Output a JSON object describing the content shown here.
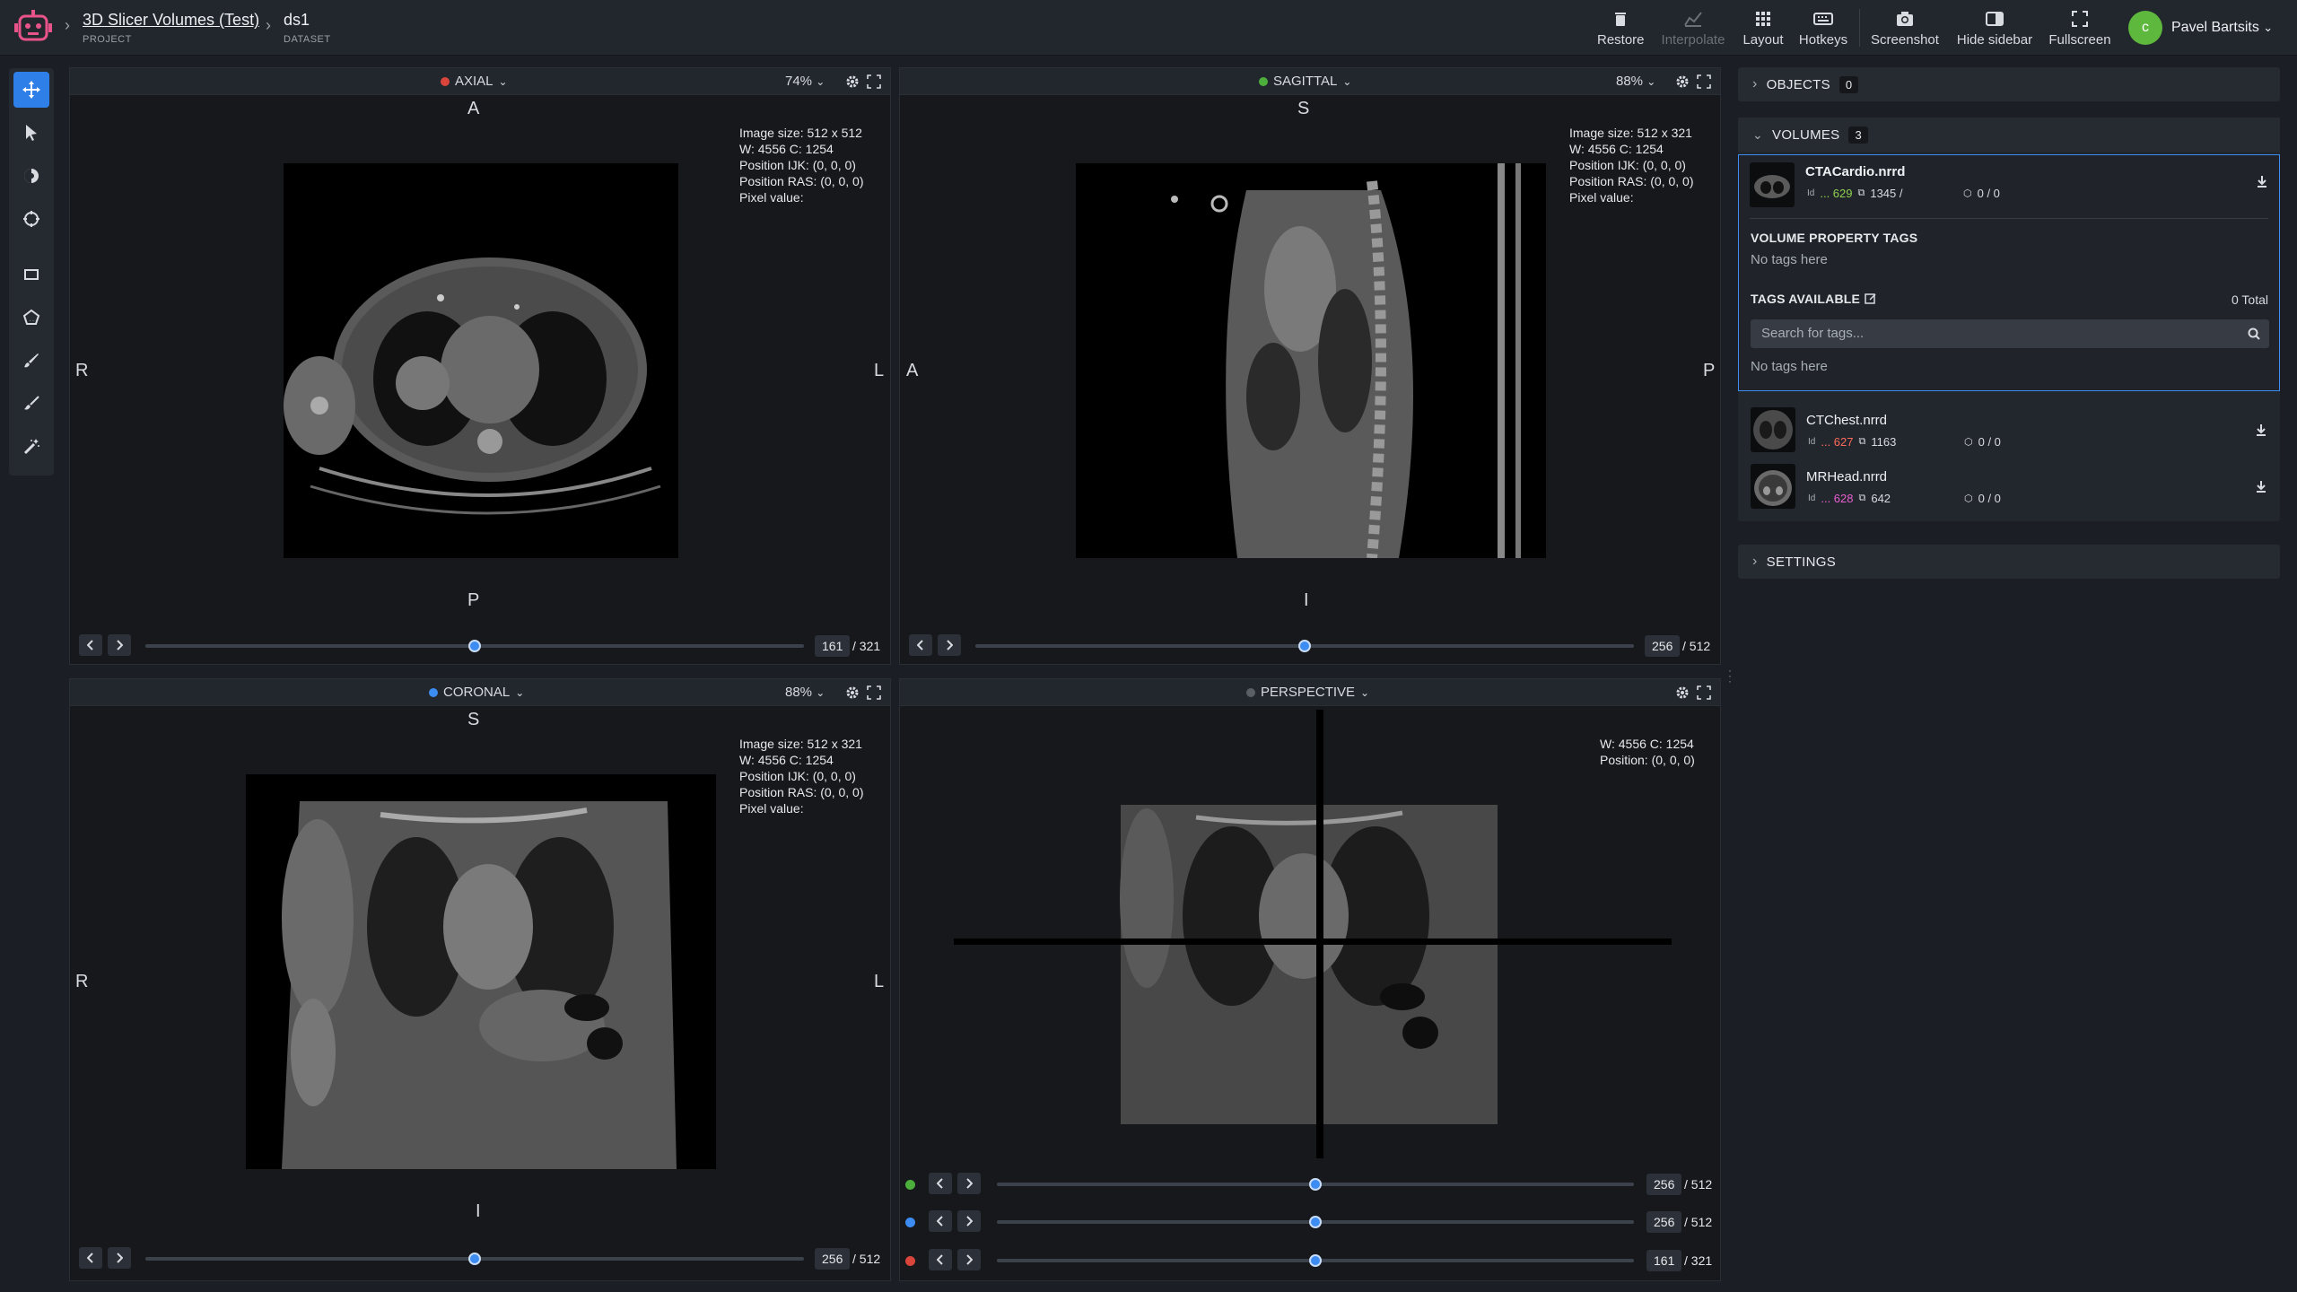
{
  "header": {
    "project_title": "3D Slicer Volumes (Test)",
    "project_label": "PROJECT",
    "dataset_title": "ds1",
    "dataset_label": "DATASET",
    "actions": [
      {
        "label": "Restore",
        "icon": "trash-icon",
        "disabled": false
      },
      {
        "label": "Interpolate",
        "icon": "chart-icon",
        "disabled": true
      },
      {
        "label": "Layout",
        "icon": "grid-icon",
        "disabled": false
      },
      {
        "label": "Hotkeys",
        "icon": "keyboard-icon",
        "disabled": false
      },
      {
        "label": "Screenshot",
        "icon": "camera-icon",
        "disabled": false
      },
      {
        "label": "Hide sidebar",
        "icon": "sidebar-icon",
        "disabled": false
      },
      {
        "label": "Fullscreen",
        "icon": "fullscreen-icon",
        "disabled": false
      }
    ],
    "user": {
      "initial": "c",
      "name": "Pavel Bartsits"
    }
  },
  "tools": [
    "move-icon",
    "pointer-icon",
    "brightness-icon",
    "point-icon",
    "rectangle-icon",
    "polygon-icon",
    "brush-icon",
    "eraser-brush-icon",
    "magic-wand-icon"
  ],
  "viewports": {
    "axial": {
      "title": "AXIAL",
      "color": "#d9453b",
      "zoom": "74%",
      "orient": {
        "top": "A",
        "bottom": "P",
        "left": "R",
        "right": "L"
      },
      "info": [
        "Image size: 512 x 512",
        "W: 4556 C: 1254",
        "Position IJK: (0, 0, 0)",
        "Position RAS: (0, 0, 0)",
        "Pixel value:"
      ],
      "slice": "161",
      "total": "/ 321",
      "fraction": 0.5
    },
    "sagittal": {
      "title": "SAGITTAL",
      "color": "#4caf3c",
      "zoom": "88%",
      "orient": {
        "top": "S",
        "bottom": "I",
        "left": "A",
        "right": "P"
      },
      "info": [
        "Image size: 512 x 321",
        "W: 4556 C: 1254",
        "Position IJK: (0, 0, 0)",
        "Position RAS: (0, 0, 0)",
        "Pixel value:"
      ],
      "slice": "256",
      "total": "/ 512",
      "fraction": 0.5
    },
    "coronal": {
      "title": "CORONAL",
      "color": "#3d8cf2",
      "zoom": "88%",
      "orient": {
        "top": "S",
        "bottom": "I",
        "left": "R",
        "right": "L"
      },
      "info": [
        "Image size: 512 x 321",
        "W: 4556 C: 1254",
        "Position IJK: (0, 0, 0)",
        "Position RAS: (0, 0, 0)",
        "Pixel value:"
      ],
      "slice": "256",
      "total": "/ 512",
      "fraction": 0.5
    },
    "perspective": {
      "title": "PERSPECTIVE",
      "color": "#5a5f66",
      "info": [
        "W: 4556 C: 1254",
        "Position: (0, 0, 0)"
      ],
      "sliders": [
        {
          "color": "#4caf3c",
          "slice": "256",
          "total": "/ 512",
          "fraction": 0.5
        },
        {
          "color": "#3d8cf2",
          "slice": "256",
          "total": "/ 512",
          "fraction": 0.5
        },
        {
          "color": "#d9453b",
          "slice": "161",
          "total": "/ 321",
          "fraction": 0.5
        }
      ]
    }
  },
  "sidebar": {
    "objects": {
      "label": "OBJECTS",
      "count": "0"
    },
    "volumes": {
      "label": "VOLUMES",
      "count": "3"
    },
    "settings": {
      "label": "SETTINGS"
    },
    "volume_items": [
      {
        "name": "CTACardio.nrrd",
        "id": "... 629",
        "id_color": "#8fd14f",
        "frames": "1345 /",
        "objects": "0 / 0"
      },
      {
        "name": "CTChest.nrrd",
        "id": "... 627",
        "id_color": "#ff6b5a",
        "frames": "1163",
        "objects": "0 / 0"
      },
      {
        "name": "MRHead.nrrd",
        "id": "... 628",
        "id_color": "#e85fd0",
        "frames": "642",
        "objects": "0 / 0"
      }
    ],
    "property_tags_label": "VOLUME PROPERTY TAGS",
    "property_tags_empty": "No tags here",
    "tags_available_label": "TAGS AVAILABLE",
    "tags_total": "0 Total",
    "search_placeholder": "Search for tags...",
    "tags_empty": "No tags here"
  }
}
